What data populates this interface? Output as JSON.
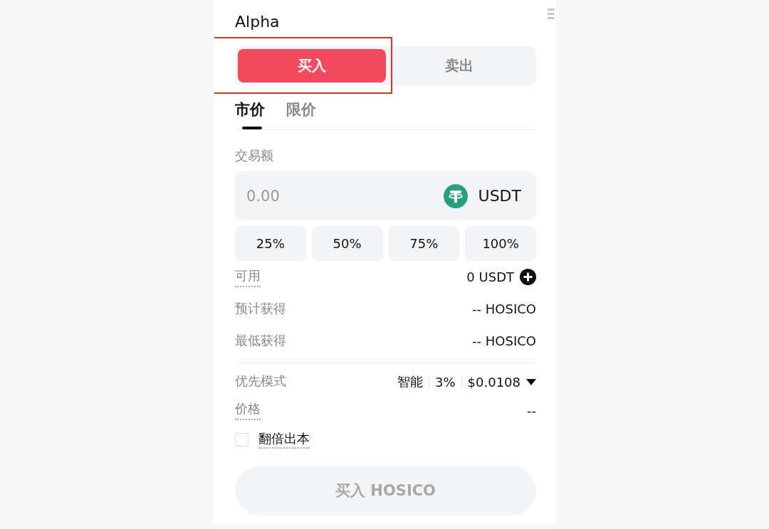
{
  "title": "Alpha",
  "sides": [
    {
      "label": "买入",
      "selected": true
    },
    {
      "label": "卖出",
      "selected": false
    }
  ],
  "order_types": [
    {
      "label": "市价",
      "selected": true
    },
    {
      "label": "限价",
      "selected": false
    }
  ],
  "amount": {
    "label": "交易额",
    "placeholder": "0.00",
    "currency": "USDT"
  },
  "percent_buttons": [
    "25%",
    "50%",
    "75%",
    "100%"
  ],
  "info_rows": [
    {
      "label": "可用",
      "value": "0 USDT",
      "underlined": true,
      "kind": "deposit"
    },
    {
      "label": "预计获得",
      "value": "-- HOSICO",
      "underlined": false,
      "kind": "plain"
    },
    {
      "label": "最低获得",
      "value": "-- HOSICO",
      "underlined": false,
      "kind": "plain"
    }
  ],
  "priority": {
    "label": "优先模式",
    "values": [
      "智能",
      "3%",
      "$0.0108"
    ]
  },
  "price": {
    "label": "价格",
    "value": "--",
    "underlined": true
  },
  "double_principal": {
    "label": "翻倍出本",
    "checked": false
  },
  "submit": {
    "label": "买入 HOSICO",
    "disabled": true
  }
}
